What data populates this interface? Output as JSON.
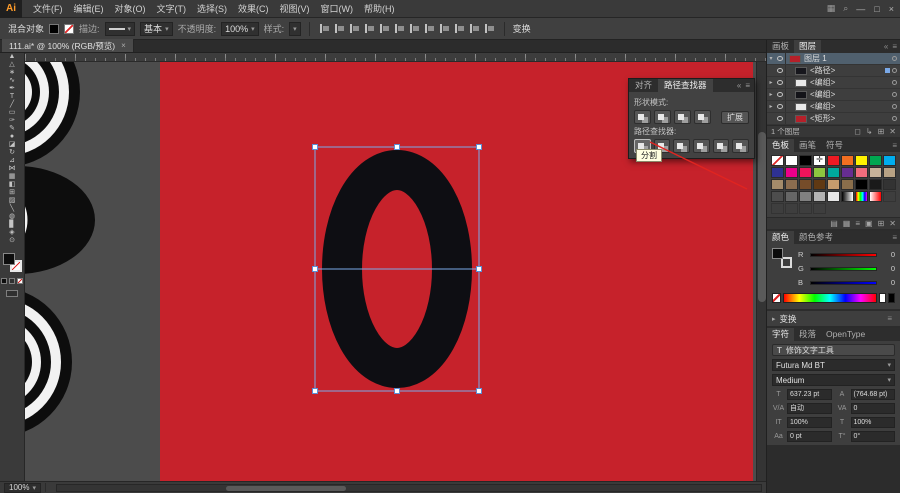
{
  "app": {
    "logo": "Ai",
    "window_controls": [
      "—",
      "□",
      "×"
    ]
  },
  "icons": {
    "caret_down": "▾",
    "caret_right": "▸",
    "close": "×",
    "menu": "≡",
    "collapse": "«",
    "grid": "▦",
    "search": "⌕"
  },
  "menubar": {
    "items": [
      "文件(F)",
      "编辑(E)",
      "对象(O)",
      "文字(T)",
      "选择(S)",
      "效果(C)",
      "视图(V)",
      "窗口(W)",
      "帮助(H)"
    ]
  },
  "control_bar": {
    "context_label": "混合对象",
    "stroke_label": "描边:",
    "brush_name": "基本",
    "opacity_label": "不透明度:",
    "opacity_value": "100%",
    "style_label": "样式:",
    "transform_label": "变换",
    "align_icons": [
      {
        "name": "align-left-icon"
      },
      {
        "name": "align-center-h-icon"
      },
      {
        "name": "align-right-icon"
      },
      {
        "name": "align-top-icon"
      },
      {
        "name": "align-middle-icon"
      },
      {
        "name": "align-bottom-icon"
      },
      {
        "name": "distribute-left-icon"
      },
      {
        "name": "distribute-center-h-icon"
      },
      {
        "name": "distribute-right-icon"
      },
      {
        "name": "distribute-top-icon"
      },
      {
        "name": "distribute-middle-icon"
      },
      {
        "name": "distribute-bottom-icon"
      }
    ]
  },
  "doc_tab": {
    "title": "111.ai* @ 100% (RGB/预览)"
  },
  "toolbar": {
    "tools": [
      {
        "name": "selection-tool",
        "glyph": "▲"
      },
      {
        "name": "direct-selection-tool",
        "glyph": "△"
      },
      {
        "name": "magic-wand-tool",
        "glyph": "∗"
      },
      {
        "name": "lasso-tool",
        "glyph": "∿"
      },
      {
        "name": "pen-tool",
        "glyph": "✒"
      },
      {
        "name": "type-tool",
        "glyph": "T"
      },
      {
        "name": "line-segment-tool",
        "glyph": "╱"
      },
      {
        "name": "rectangle-tool",
        "glyph": "▭"
      },
      {
        "name": "paintbrush-tool",
        "glyph": "✑"
      },
      {
        "name": "pencil-tool",
        "glyph": "✎"
      },
      {
        "name": "blob-brush-tool",
        "glyph": "●"
      },
      {
        "name": "eraser-tool",
        "glyph": "◪"
      },
      {
        "name": "rotate-tool",
        "glyph": "↻"
      },
      {
        "name": "scale-tool",
        "glyph": "⊿"
      },
      {
        "name": "width-tool",
        "glyph": "⋈"
      },
      {
        "name": "free-transform-tool",
        "glyph": "▦"
      },
      {
        "name": "shape-builder-tool",
        "glyph": "◧"
      },
      {
        "name": "perspective-grid-tool",
        "glyph": "⊞"
      },
      {
        "name": "gradient-tool",
        "glyph": "▨"
      },
      {
        "name": "eyedropper-tool",
        "glyph": "╲"
      },
      {
        "name": "blend-tool",
        "glyph": "◍"
      },
      {
        "name": "column-graph-tool",
        "glyph": "▊"
      },
      {
        "name": "hand-tool",
        "glyph": "◈"
      },
      {
        "name": "zoom-tool",
        "glyph": "⊙"
      }
    ]
  },
  "canvas": {
    "artboard_color": "#c6222b",
    "glyph_color": "#0e0e13",
    "selection_color": "#7aa9e8"
  },
  "pathfinder": {
    "tabs": [
      {
        "label": "对齐",
        "active": ""
      },
      {
        "label": "路径查找器",
        "active": "active"
      }
    ],
    "shape_modes_label": "形状模式:",
    "shape_modes": [
      {
        "name": "unite-icon"
      },
      {
        "name": "minus-front-icon"
      },
      {
        "name": "intersect-icon"
      },
      {
        "name": "exclude-icon"
      }
    ],
    "expand_label": "扩展",
    "pathfinders_label": "路径查找器:",
    "finders": [
      {
        "name": "divide-icon"
      },
      {
        "name": "trim-icon"
      },
      {
        "name": "merge-icon"
      },
      {
        "name": "crop-icon"
      },
      {
        "name": "outline-icon"
      },
      {
        "name": "minus-back-icon"
      }
    ],
    "tooltip": "分割"
  },
  "layers": {
    "tabs": [
      {
        "label": "画板",
        "active": ""
      },
      {
        "label": "图层",
        "active": "active"
      }
    ],
    "rows": [
      {
        "caret": "▾",
        "label": "图层 1",
        "variant": "layer sel",
        "thumb": "#b6202a"
      },
      {
        "caret": "",
        "label": "<路径>",
        "variant": "child picked",
        "thumb": "#17171d"
      },
      {
        "caret": "▸",
        "label": "<编组>",
        "variant": "child",
        "thumb": "#e8e8e8"
      },
      {
        "caret": "▸",
        "label": "<编组>",
        "variant": "child",
        "thumb": "#141419"
      },
      {
        "caret": "▸",
        "label": "<编组>",
        "variant": "child",
        "thumb": "#e8e8e8"
      },
      {
        "caret": "",
        "label": "<矩形>",
        "variant": "child",
        "thumb": "#b6202a"
      }
    ],
    "status": "1 个图层",
    "bottom_icons": [
      {
        "name": "make-mask-icon",
        "glyph": "◻"
      },
      {
        "name": "new-sublayer-icon",
        "glyph": "↳"
      },
      {
        "name": "new-layer-icon",
        "glyph": "⊞"
      },
      {
        "name": "delete-layer-icon",
        "glyph": "✕"
      }
    ]
  },
  "swatches": {
    "tabs": [
      {
        "label": "色板",
        "active": "active"
      },
      {
        "label": "画笔",
        "active": ""
      },
      {
        "label": "符号",
        "active": ""
      }
    ],
    "cells": [
      "none",
      "#ffffff",
      "#000000",
      "reg",
      "#ed1a23",
      "#f36f21",
      "#fff200",
      "#00a650",
      "#00adee",
      "#2e3192",
      "#eb008b",
      "#ee145b",
      "#8dc63f",
      "#00a99e",
      "#662d91",
      "#f26d7d",
      "#c7b299",
      "#b8a284",
      "#a48b6a",
      "#8c6d4f",
      "#754c29",
      "#603913",
      "#c69c6d",
      "#8a6e4b",
      "#000000",
      "#1a1a1a",
      "#333333",
      "#4d4d4d",
      "#666666",
      "#808080",
      "#b3b3b3",
      "#e6e6e6",
      "linear-gradient(90deg,#000,#fff)",
      "linear-gradient(90deg,#f00,#ff0,#0f0,#0ff,#00f,#f0f)",
      "linear-gradient(90deg,#fff,#f00)",
      "empty",
      "empty",
      "empty",
      "empty",
      "empty"
    ],
    "bottom_icons": [
      {
        "name": "swatch-libraries-icon",
        "glyph": "▤"
      },
      {
        "name": "swatch-kinds-icon",
        "glyph": "▦"
      },
      {
        "name": "swatch-options-icon",
        "glyph": "≡"
      },
      {
        "name": "new-color-group-icon",
        "glyph": "▣"
      },
      {
        "name": "new-swatch-icon",
        "glyph": "⊞"
      },
      {
        "name": "delete-swatch-icon",
        "glyph": "✕"
      }
    ]
  },
  "color": {
    "tabs": [
      {
        "label": "颜色",
        "active": "active"
      },
      {
        "label": "颜色参考",
        "active": ""
      }
    ],
    "sliders": [
      {
        "label": "R",
        "value": "0",
        "track": "linear-gradient(90deg,#000,#f00)"
      },
      {
        "label": "G",
        "value": "0",
        "track": "linear-gradient(90deg,#000,#0f0)"
      },
      {
        "label": "B",
        "value": "0",
        "track": "linear-gradient(90deg,#000,#00f)"
      }
    ]
  },
  "transform": {
    "title": "变换"
  },
  "character": {
    "tabs": [
      {
        "label": "字符",
        "active": "active"
      },
      {
        "label": "段落",
        "active": ""
      },
      {
        "label": "OpenType",
        "active": ""
      }
    ],
    "touch_icon": "T",
    "touch_label": "修饰文字工具",
    "font": "Futura Md BT",
    "style": "Medium",
    "fields": [
      {
        "icon": "T",
        "value": "637.23 pt"
      },
      {
        "icon": "A",
        "value": "(764.68 pt)"
      },
      {
        "icon": "V/A",
        "value": "自动"
      },
      {
        "icon": "VA",
        "value": "0"
      },
      {
        "icon": "IT",
        "value": "100%"
      },
      {
        "icon": "T",
        "value": "100%"
      },
      {
        "icon": "Aa",
        "value": "0 pt"
      },
      {
        "icon": "T°",
        "value": "0°"
      }
    ]
  },
  "status_bar": {
    "zoom": "100%"
  }
}
